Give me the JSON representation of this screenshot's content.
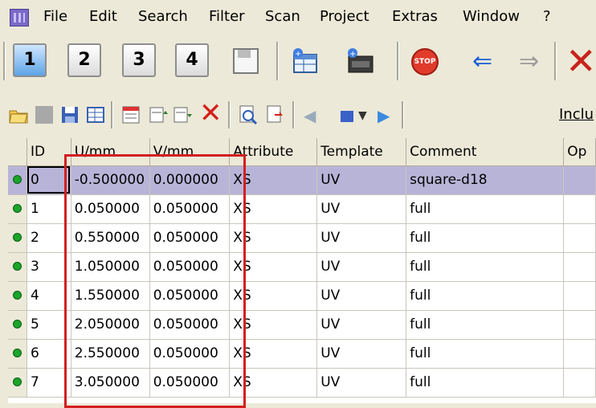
{
  "menu": [
    "File",
    "Edit",
    "Search",
    "Filter",
    "Scan",
    "Project",
    "Extras",
    "Window",
    "?"
  ],
  "toolbar1": {
    "layer_buttons": [
      "1",
      "2",
      "3",
      "4"
    ],
    "stop_label": "STOP"
  },
  "toolbar2": {
    "include_label": "Inclu"
  },
  "table": {
    "columns": [
      "ID",
      "U/mm",
      "V/mm",
      "Attribute",
      "Template",
      "Comment",
      "Op"
    ],
    "rows": [
      {
        "id": "0",
        "u": "-0.500000",
        "v": "0.000000",
        "attr": "XS",
        "tmpl": "UV",
        "comment": "square-d18"
      },
      {
        "id": "1",
        "u": "0.050000",
        "v": "0.050000",
        "attr": "XS",
        "tmpl": "UV",
        "comment": "full"
      },
      {
        "id": "2",
        "u": "0.550000",
        "v": "0.050000",
        "attr": "XS",
        "tmpl": "UV",
        "comment": "full"
      },
      {
        "id": "3",
        "u": "1.050000",
        "v": "0.050000",
        "attr": "XS",
        "tmpl": "UV",
        "comment": "full"
      },
      {
        "id": "4",
        "u": "1.550000",
        "v": "0.050000",
        "attr": "XS",
        "tmpl": "UV",
        "comment": "full"
      },
      {
        "id": "5",
        "u": "2.050000",
        "v": "0.050000",
        "attr": "XS",
        "tmpl": "UV",
        "comment": "full"
      },
      {
        "id": "6",
        "u": "2.550000",
        "v": "0.050000",
        "attr": "XS",
        "tmpl": "UV",
        "comment": "full"
      },
      {
        "id": "7",
        "u": "3.050000",
        "v": "0.050000",
        "attr": "XS",
        "tmpl": "UV",
        "comment": "full"
      }
    ]
  },
  "colors": {
    "highlight_box": "#d31f1f",
    "selected_row": "#b8b4d8",
    "status_dot": "#1aa52a"
  }
}
